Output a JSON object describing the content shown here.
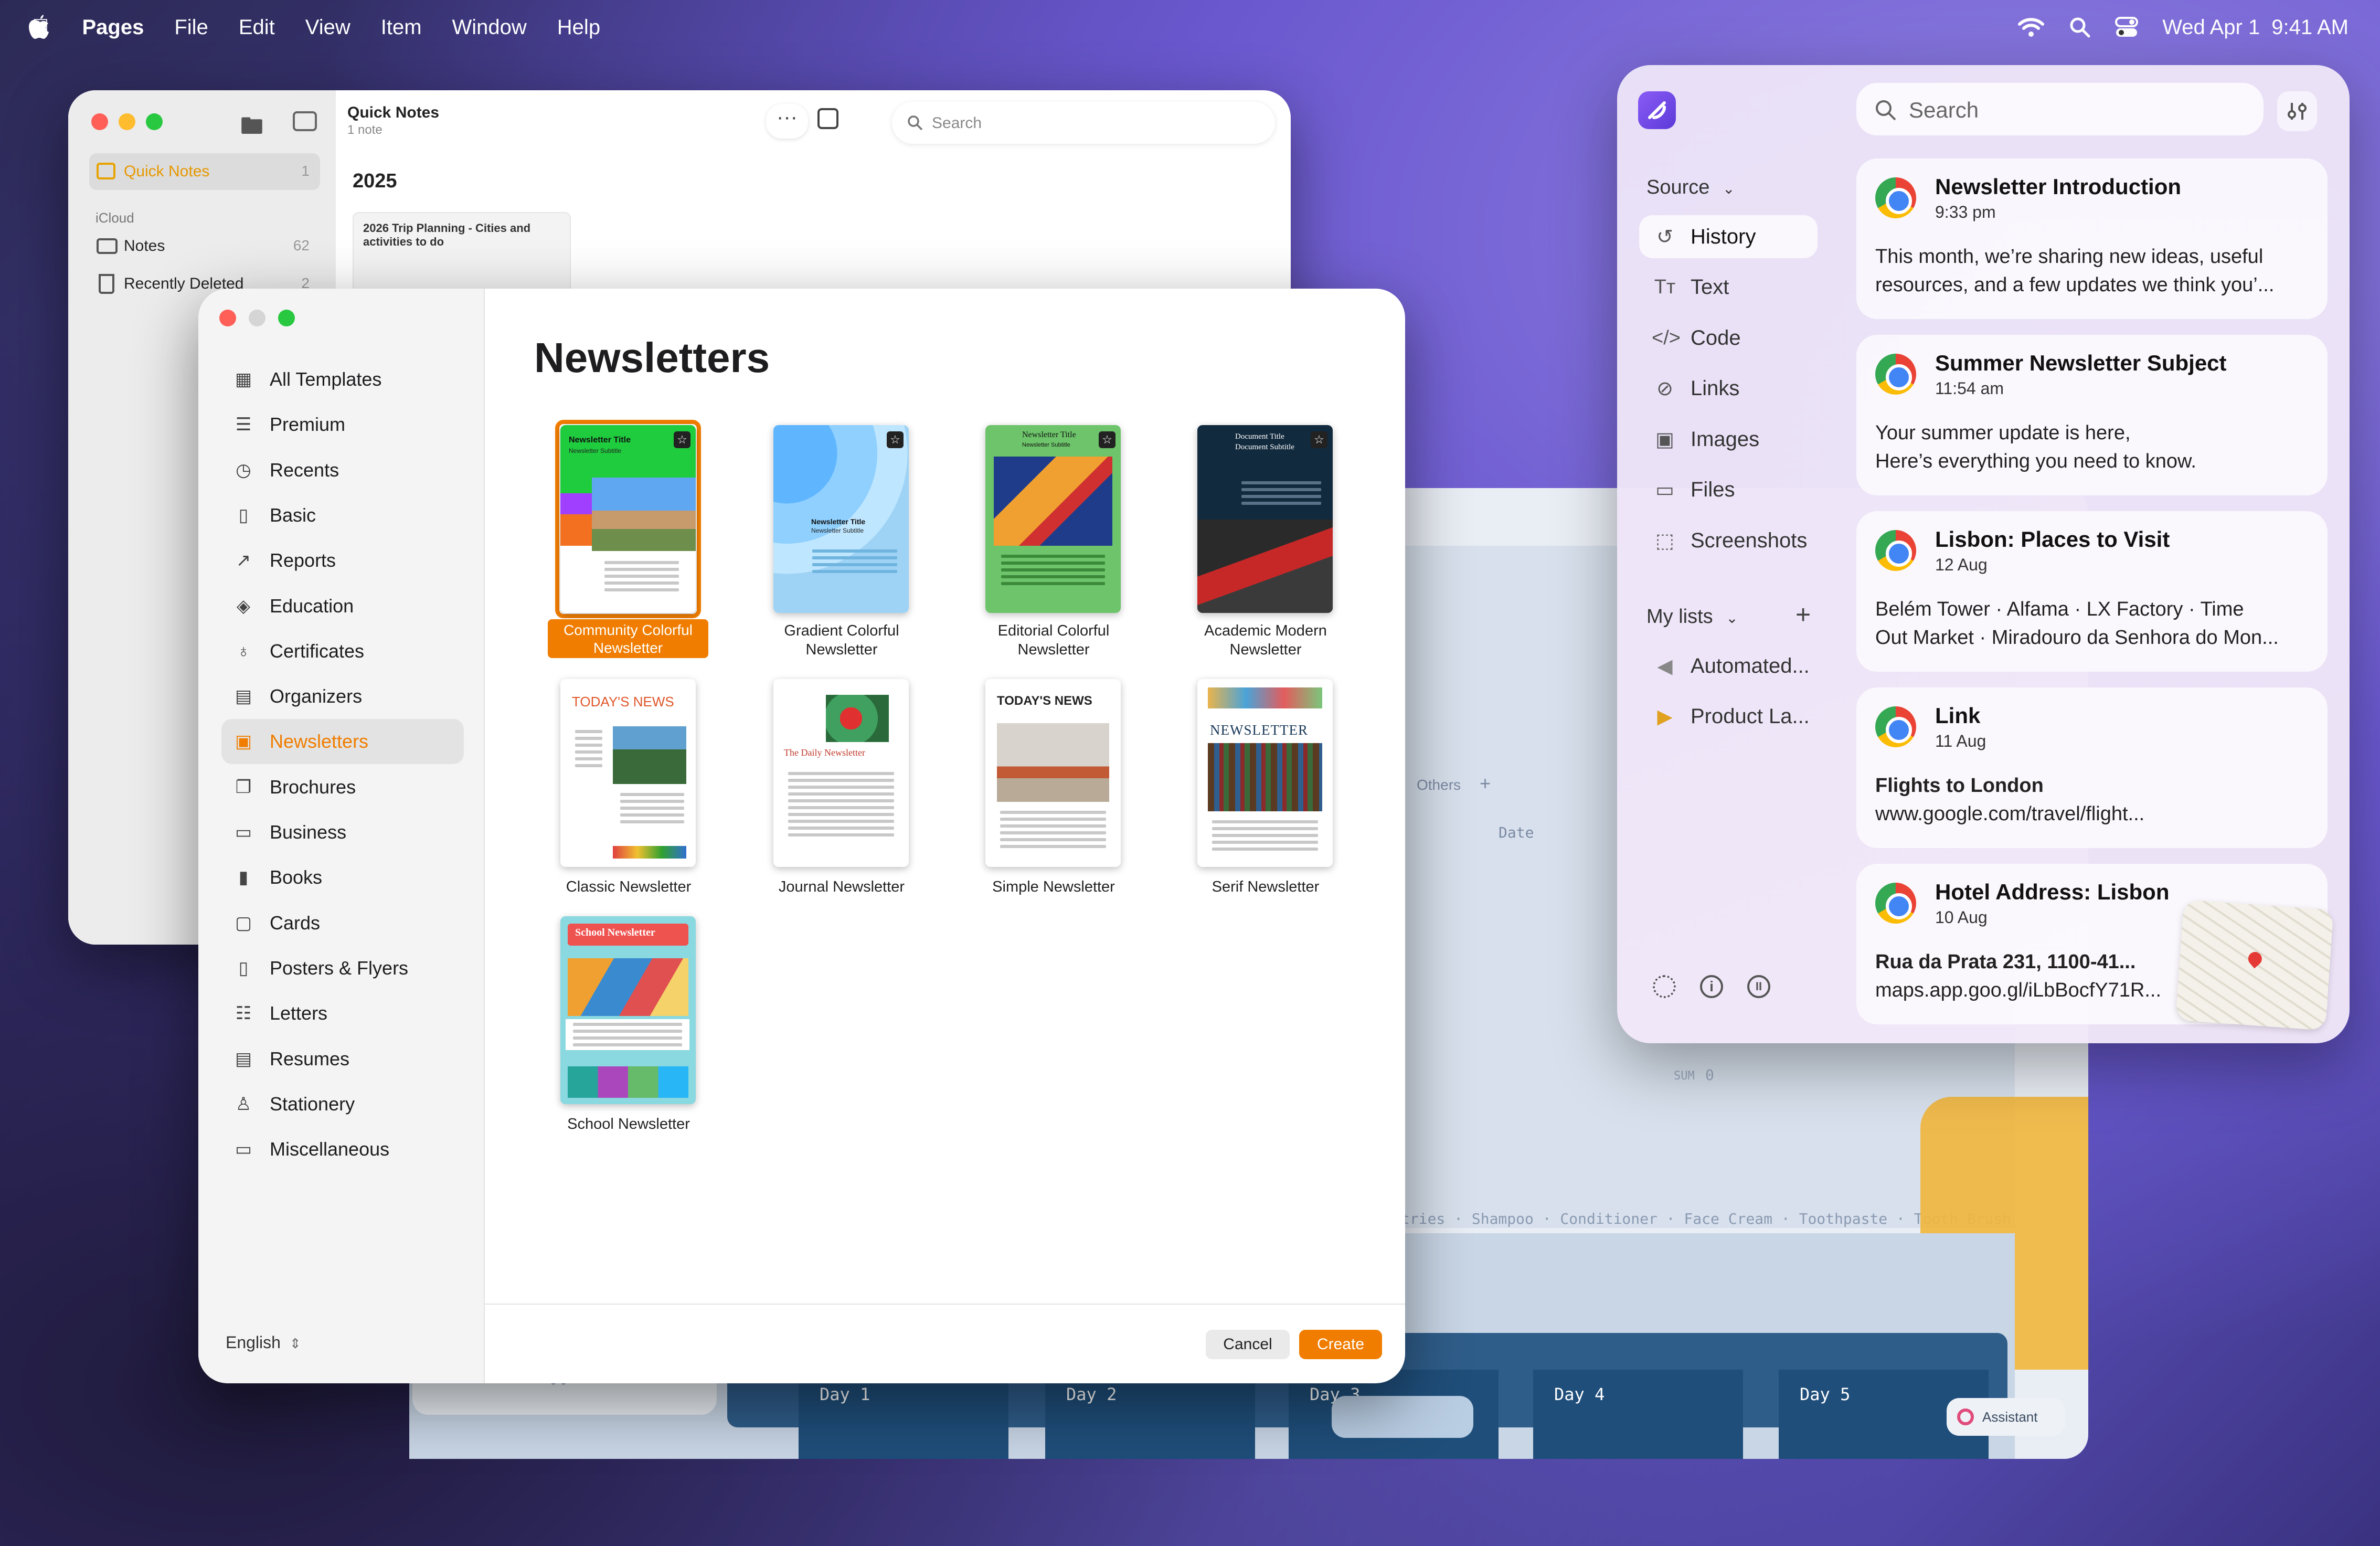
{
  "menubar": {
    "app": "Pages",
    "items": [
      "File",
      "Edit",
      "View",
      "Item",
      "Window",
      "Help"
    ],
    "date": "Wed Apr 1",
    "time": "9:41 AM"
  },
  "notes": {
    "title": "Quick Notes",
    "subtitle": "1 note",
    "search_placeholder": "Search",
    "sidebar": {
      "quick_notes": "Quick Notes",
      "quick_notes_count": "1",
      "section": "iCloud",
      "notes": "Notes",
      "notes_count": "62",
      "recently_deleted": "Recently Deleted",
      "recently_deleted_count": "2"
    },
    "year": "2025",
    "note_title": "2026 Trip Planning - Cities and activities to do"
  },
  "back_window": {
    "others": "Others",
    "date": "Date",
    "sum": "SUM",
    "sum_value": "0",
    "items": "tries · Shampoo · Conditioner · Face Cream · Toothpaste · Tooth Brush",
    "days": [
      "Day 1",
      "Day 2",
      "Day 3",
      "Day 4",
      "Day 5"
    ],
    "assistant": "Assistant"
  },
  "pages": {
    "heading": "Newsletters",
    "categories": [
      {
        "icon": "grid-icon",
        "label": "All Templates"
      },
      {
        "icon": "premium-icon",
        "label": "Premium"
      },
      {
        "icon": "clock-icon",
        "label": "Recents"
      },
      {
        "icon": "doc-icon",
        "label": "Basic"
      },
      {
        "icon": "chart-icon",
        "label": "Reports"
      },
      {
        "icon": "graduation-icon",
        "label": "Education"
      },
      {
        "icon": "ribbon-icon",
        "label": "Certificates"
      },
      {
        "icon": "calendar-icon",
        "label": "Organizers"
      },
      {
        "icon": "newsletter-icon",
        "label": "Newsletters"
      },
      {
        "icon": "brochure-icon",
        "label": "Brochures"
      },
      {
        "icon": "briefcase-icon",
        "label": "Business"
      },
      {
        "icon": "book-icon",
        "label": "Books"
      },
      {
        "icon": "card-icon",
        "label": "Cards"
      },
      {
        "icon": "poster-icon",
        "label": "Posters & Flyers"
      },
      {
        "icon": "letter-icon",
        "label": "Letters"
      },
      {
        "icon": "resume-icon",
        "label": "Resumes"
      },
      {
        "icon": "stationery-icon",
        "label": "Stationery"
      },
      {
        "icon": "misc-icon",
        "label": "Miscellaneous"
      }
    ],
    "language": "English",
    "templates": [
      {
        "label1": "Community Colorful",
        "label2": "Newsletter"
      },
      {
        "label1": "Gradient Colorful",
        "label2": "Newsletter"
      },
      {
        "label1": "Editorial Colorful",
        "label2": "Newsletter"
      },
      {
        "label1": "Academic Modern",
        "label2": "Newsletter"
      },
      {
        "label1": "Classic Newsletter",
        "label2": ""
      },
      {
        "label1": "Journal Newsletter",
        "label2": ""
      },
      {
        "label1": "Simple Newsletter",
        "label2": ""
      },
      {
        "label1": "Serif Newsletter",
        "label2": ""
      },
      {
        "label1": "School Newsletter",
        "label2": ""
      }
    ],
    "thumb_text": {
      "t1_title": "Newsletter Title",
      "t1_sub": "Newsletter Subtitle",
      "t2_title": "Newsletter Title",
      "t2_sub": "Newsletter Subtitle",
      "t3_title": "Newsletter Title",
      "t3_sub": "Newsletter Subtitle",
      "t4_title": "Document Title",
      "t4_sub": "Document Subtitle",
      "t5_title": "TODAY'S NEWS",
      "t6_title": "The Daily Newsletter",
      "t7_title": "TODAY'S NEWS",
      "t8_title": "NEWSLETTER",
      "t9_title": "School Newsletter"
    },
    "cancel": "Cancel",
    "create": "Create",
    "colors": {
      "accent": "#f07d00"
    }
  },
  "clipboard": {
    "search_placeholder": "Search",
    "source_label": "Source",
    "sources": [
      {
        "icon": "history-icon",
        "label": "History"
      },
      {
        "icon": "text-icon",
        "label": "Text"
      },
      {
        "icon": "code-icon",
        "label": "Code"
      },
      {
        "icon": "link-icon",
        "label": "Links"
      },
      {
        "icon": "image-icon",
        "label": "Images"
      },
      {
        "icon": "folder-icon",
        "label": "Files"
      },
      {
        "icon": "screenshot-icon",
        "label": "Screenshots"
      }
    ],
    "mylists_label": "My lists",
    "lists": [
      {
        "icon": "megaphone-icon",
        "label": "Automated..."
      },
      {
        "icon": "launch-icon",
        "label": "Product La..."
      }
    ],
    "cards": [
      {
        "title": "Newsletter Introduction",
        "sub": "9:33 pm",
        "body1": "This month, we’re sharing new ideas, useful",
        "body2": "resources, and a few updates we think you’..."
      },
      {
        "title": "Summer Newsletter Subject",
        "sub": "11:54 am",
        "body1": "Your summer update is here,",
        "body2": "Here’s everything you need to know."
      },
      {
        "title": "Lisbon: Places to Visit",
        "sub": "12 Aug",
        "body1": "Belém Tower · Alfama · LX Factory · Time",
        "body2": "Out Market · Miradouro da Senhora do Mon..."
      },
      {
        "title": "Link",
        "sub": "11 Aug",
        "body1": "Flights to London",
        "body2": "www.google.com/travel/flight..."
      },
      {
        "title": "Hotel Address: Lisbon",
        "sub": "10 Aug",
        "body1": "Rua da Prata 231, 1100-41...",
        "body2": "maps.app.goo.gl/iLbBocfY71R..."
      }
    ]
  }
}
